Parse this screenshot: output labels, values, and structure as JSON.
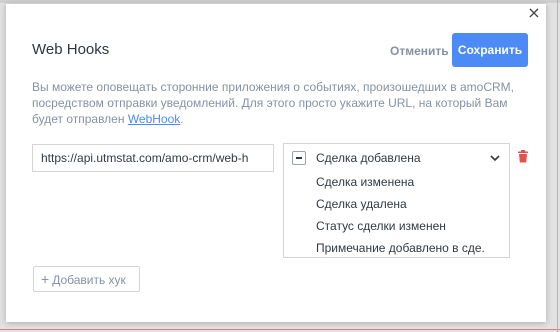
{
  "modal": {
    "title": "Web Hooks",
    "close_glyph": "×",
    "cancel_label": "Отменить",
    "save_label": "Сохранить",
    "description_part1": "Вы можете оповещать сторонние приложения о событиях, произошедших в amoCRM, посредством отправки уведомлений. Для этого просто укажите URL, на который Вам будет отправлен ",
    "description_link": "WebHook",
    "description_end": "."
  },
  "hook": {
    "url_value": "https://api.utmstat.com/amo-crm/web-h",
    "events_selected": "Сделка добавлена",
    "events_options": [
      "Сделка изменена",
      "Сделка удалена",
      "Статус сделки изменен",
      "Примечание добавлено в сде."
    ]
  },
  "add_hook": {
    "plus": "+",
    "label": "Добавить хук"
  },
  "colors": {
    "accent": "#4c8bf5",
    "muted_text": "#8591a5",
    "trash": "#e35050"
  },
  "icons": {
    "close": "close-icon",
    "chevron": "chevron-down-icon",
    "trash": "trash-icon",
    "minus_checkbox": "minus-checkbox-icon",
    "plus": "plus-icon"
  }
}
